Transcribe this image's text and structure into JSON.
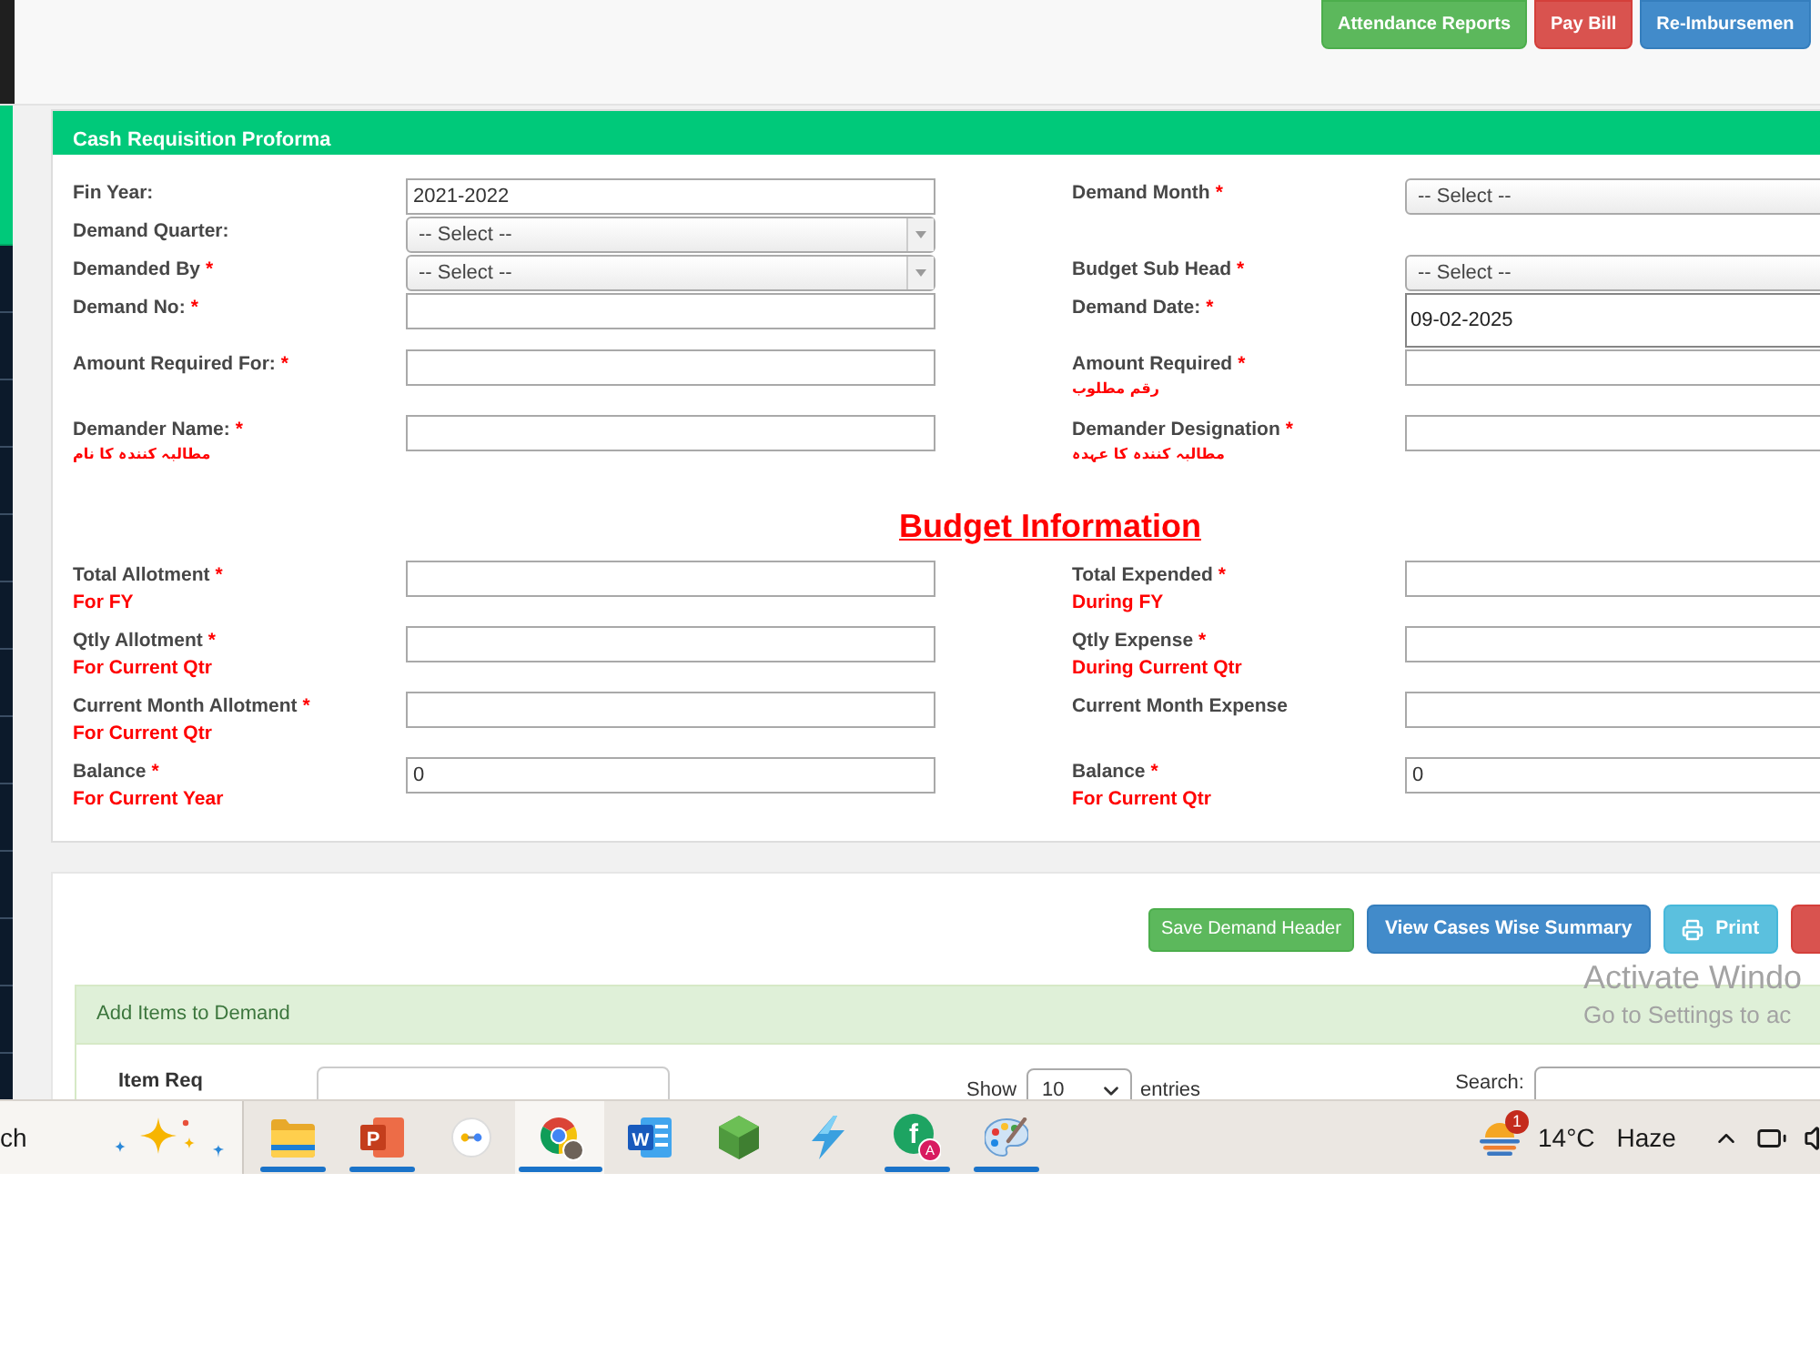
{
  "top_bar": {
    "buttons": [
      {
        "label": "Attendance Reports",
        "kind": "success"
      },
      {
        "label": "Pay Bill",
        "kind": "danger"
      },
      {
        "label": "Re-Imbursemen",
        "kind": "primary"
      }
    ]
  },
  "sidebar": {
    "items": [
      {
        "selected": true
      },
      {
        "selected": false
      },
      {
        "selected": false
      },
      {
        "selected": false
      },
      {
        "selected": false
      },
      {
        "selected": false
      },
      {
        "selected": false
      },
      {
        "selected": false
      },
      {
        "selected": false
      },
      {
        "selected": false
      },
      {
        "selected": false
      },
      {
        "selected": false
      },
      {
        "selected": false
      }
    ]
  },
  "requisition_panel": {
    "title": "Cash Requisition Proforma",
    "rows": [
      {
        "left": {
          "label": "Fin Year:",
          "kind": "input",
          "value": "2021-2022"
        },
        "right": {
          "label": "Demand Month",
          "required_mark": "*",
          "kind": "select",
          "value": "-- Select --"
        }
      },
      {
        "left": {
          "label": "Demand Quarter:",
          "kind": "select",
          "value": "-- Select --"
        }
      },
      {
        "left": {
          "label": "Demanded By",
          "required_mark": "*",
          "kind": "select",
          "value": "-- Select --"
        },
        "right": {
          "label": "Budget Sub Head",
          "required_mark": "*",
          "kind": "select",
          "value": "-- Select --"
        }
      },
      {
        "left": {
          "label": "Demand No:",
          "required_mark": "*",
          "kind": "input"
        },
        "right": {
          "label": "Demand Date:",
          "required_mark": "*",
          "kind": "date",
          "value": "09-02-2025"
        }
      },
      {
        "left": {
          "label": "Amount Required For:",
          "required_mark": "*",
          "kind": "input"
        },
        "right": {
          "label": "Amount Required",
          "required_mark": "*",
          "urdu": "رقم مطلوب",
          "kind": "input"
        }
      },
      {
        "left": {
          "label": "Demander Name:",
          "required_mark": "*",
          "urdu": "مطالبہ کنندہ کا نام",
          "kind": "input"
        },
        "right": {
          "label": "Demander Designation",
          "required_mark": "*",
          "urdu": "مطالبہ کنندہ کا عہدہ",
          "kind": "input"
        }
      }
    ],
    "budget_heading": "Budget Information",
    "budget_rows": [
      {
        "left": {
          "label": "Total Allotment",
          "required_mark": "*",
          "note": "For FY"
        },
        "right": {
          "label": "Total Expended",
          "required_mark": "*",
          "note": "During FY"
        }
      },
      {
        "left": {
          "label": "Qtly Allotment",
          "required_mark": "*",
          "note": "For Current Qtr"
        },
        "right": {
          "label": "Qtly Expense",
          "required_mark": "*",
          "note": "During Current Qtr"
        }
      },
      {
        "left": {
          "label": "Current Month Allotment",
          "required_mark": "*",
          "note": "For Current Qtr"
        },
        "right": {
          "label": "Current Month Expense"
        }
      },
      {
        "left": {
          "label": "Balance",
          "required_mark": "*",
          "note": "For Current Year",
          "value": "0"
        },
        "right": {
          "label": "Balance",
          "required_mark": "*",
          "note": "For Current Qtr",
          "value": "0"
        }
      }
    ]
  },
  "actions": [
    {
      "label": "Save Demand Header",
      "kind": "success_small"
    },
    {
      "label": "View Cases Wise Summary",
      "kind": "primary"
    },
    {
      "label": "Print",
      "kind": "info"
    },
    {
      "kind": "danger"
    }
  ],
  "items_panel": {
    "title": "Add Items to Demand",
    "item_req_label": "Item Req",
    "show_label": "Show",
    "page_size": "10",
    "entries_label": "entries",
    "search_label": "Search:"
  },
  "os_notice": {
    "title": "Activate Windo",
    "text": "Go to Settings to ac"
  },
  "taskbar": {
    "search_text": "ch",
    "apps": [
      {
        "kind": "folder",
        "running": true,
        "selected": false
      },
      {
        "kind": "slides",
        "glyph": "P",
        "running": true,
        "selected": false
      },
      {
        "kind": "dots",
        "running": false,
        "selected": false
      },
      {
        "kind": "browser",
        "running": true,
        "selected": true
      },
      {
        "kind": "document",
        "glyph": "W",
        "running": false,
        "selected": false
      },
      {
        "kind": "hexagon",
        "running": false,
        "selected": false
      },
      {
        "kind": "bolt",
        "running": false,
        "selected": false
      },
      {
        "kind": "letter_circle",
        "glyph": "f",
        "badge": "A",
        "running": true,
        "selected": false
      },
      {
        "kind": "palette",
        "running": true,
        "selected": false
      }
    ],
    "weather": {
      "badge": "1",
      "temperature": "14°C",
      "condition": "Haze"
    }
  }
}
